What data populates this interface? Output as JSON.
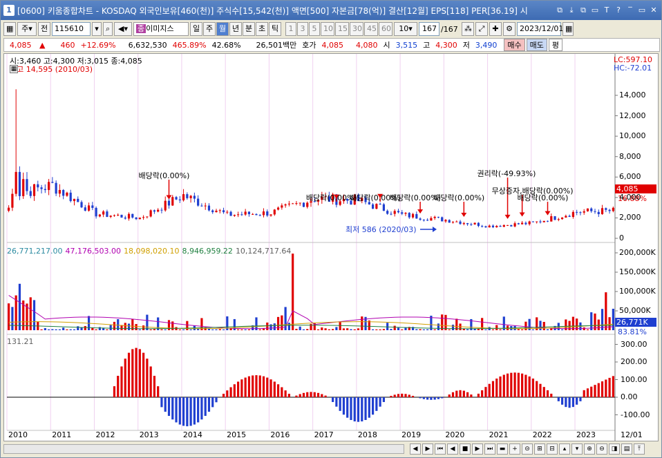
{
  "window": {
    "number": "1",
    "title": "[0600] 키움종합차트 - KOSDAQ 외국인보유[460(천)] 주식수[15,542(천)] 액면[500] 자본금[78(억)] 결산[12월] EPS[118] PER[36.19] 시",
    "buttons": [
      "⧉",
      "⤓",
      "⧉",
      "▭",
      "T",
      "?",
      "‾",
      "▭",
      "✕"
    ]
  },
  "toolbar": {
    "period_select": "주",
    "prev_label": "전",
    "code": "115610",
    "stock_name": "이미지스",
    "timeframes": [
      "일",
      "주",
      "월",
      "년",
      "분",
      "초",
      "틱"
    ],
    "active_timeframe": "월",
    "intervals": [
      "1",
      "3",
      "5",
      "10",
      "15",
      "30",
      "45",
      "60"
    ],
    "custom_interval": "10",
    "page": "167",
    "page_total": "/167",
    "date": "2023/12/01"
  },
  "infobar": {
    "price": "4,085",
    "arrow": "▲",
    "change": "460",
    "change_pct": "+12.69%",
    "volume": "6,632,530",
    "vol_ratio": "465.89%",
    "turnover": "42.68%",
    "amount": "26,501백만",
    "hoga_label": "호가",
    "ask": "4,085",
    "bid": "4,080",
    "open_label": "시",
    "open": "3,515",
    "high_label": "고",
    "high": "4,300",
    "low_label": "저",
    "low": "3,490",
    "buy": "매수",
    "sell": "매도",
    "eval": "평"
  },
  "price_pane": {
    "ohlc": "시:3,460 고:4,300 저:3,015 종:4,085",
    "max_label": "최고 14,595 (2010/03)",
    "min_label": "최저 586 (2020/03)",
    "lc": "LC:597.10",
    "hc": "HC:-72.01",
    "last_price": "4,085",
    "last_pct": "16.88%",
    "y_ticks": [
      "14,000",
      "12,000",
      "10,000",
      "8,000",
      "6,000",
      "4,000",
      "2,000",
      "0"
    ],
    "annotations": [
      {
        "text": "배당락(0.00%)"
      },
      {
        "text": "배당락(0.00%)"
      },
      {
        "text": "배당락(0.00%)"
      },
      {
        "text": "배당락(0.00%)"
      },
      {
        "text": "배당락(0.00%)"
      },
      {
        "text": "권리락(-49.93%)"
      },
      {
        "text": "무상증자,배당락(0.00%)"
      },
      {
        "text": "배당락(0.00%)"
      }
    ],
    "colors": {
      "up": "#e00000",
      "down": "#1f3fd0"
    }
  },
  "volume_pane": {
    "legend": [
      {
        "text": "26,771,217.00",
        "color": "#2a8aa0"
      },
      {
        "text": "47,176,503.00",
        "color": "#b000b0"
      },
      {
        "text": "18,098,020.10",
        "color": "#d0a000"
      },
      {
        "text": "8,946,959.22",
        "color": "#208040"
      },
      {
        "text": "10,124,717.64",
        "color": "#606060"
      }
    ],
    "y_ticks": [
      "200,000K",
      "150,000K",
      "100,000K",
      "50,000K"
    ],
    "last_value": "26,771K",
    "last_pct": "83.81%"
  },
  "osc_pane": {
    "legend": "131.21",
    "y_ticks": [
      "300.00",
      "200.00",
      "100.00",
      "0.00",
      "-100.00"
    ]
  },
  "x_axis": {
    "labels": [
      "2010",
      "2011",
      "2012",
      "2013",
      "2014",
      "2015",
      "2016",
      "2017",
      "2018",
      "2019",
      "2020",
      "2021",
      "2022",
      "2023",
      "12/01"
    ]
  },
  "chart_data": {
    "type": "bar",
    "categories": [
      "2010",
      "2011",
      "2012",
      "2013",
      "2014",
      "2015",
      "2016",
      "2017",
      "2018",
      "2019",
      "2020",
      "2021",
      "2022",
      "2023"
    ],
    "series": [
      {
        "values": [
          4200,
          2200,
          1900,
          3600,
          2400,
          2300,
          3800,
          3600,
          2400,
          1900,
          1600,
          1300,
          2400,
          4085
        ]
      }
    ],
    "ylim": [
      0,
      14000
    ]
  }
}
